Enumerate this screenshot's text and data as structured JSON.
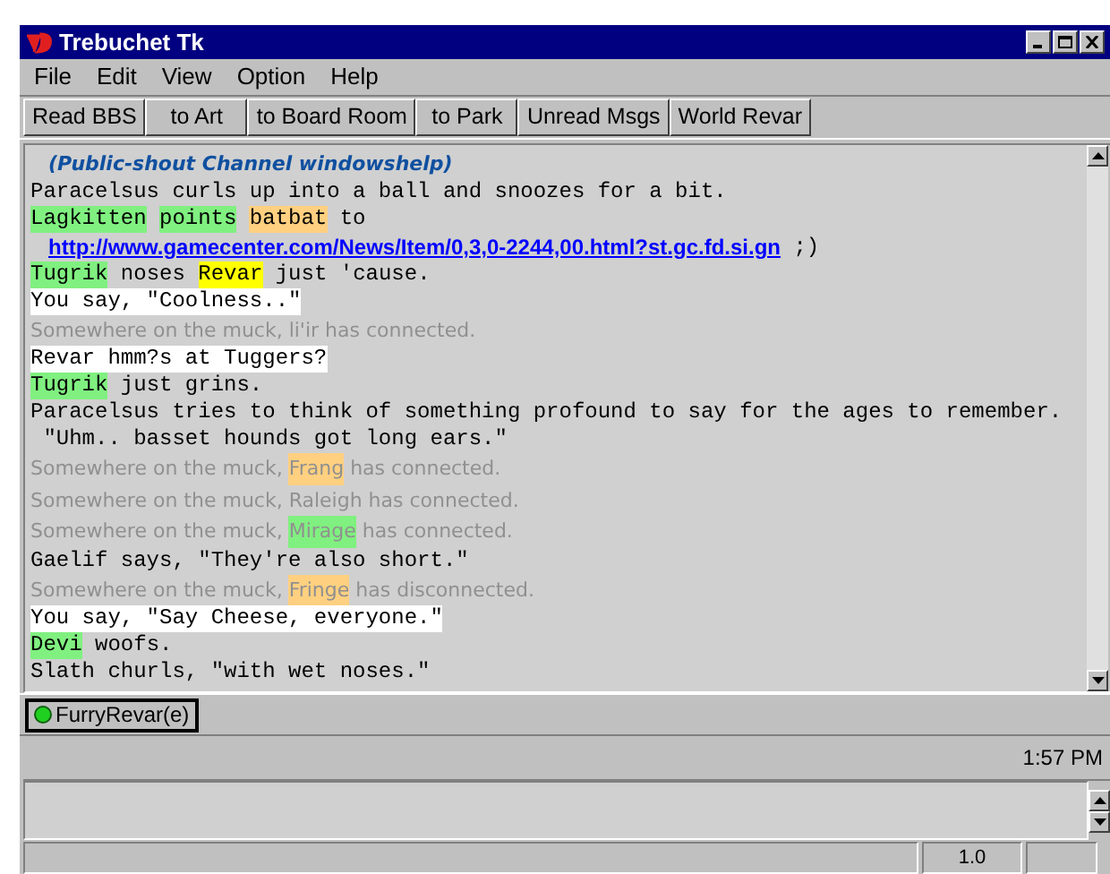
{
  "window": {
    "title": "Trebuchet Tk"
  },
  "menu": [
    "File",
    "Edit",
    "View",
    "Option",
    "Help"
  ],
  "toolbar": [
    "Read BBS",
    "to Art",
    "to Board Room",
    "to Park",
    "Unread Msgs",
    "World Revar"
  ],
  "lines": [
    {
      "kind": "header",
      "segments": [
        {
          "text": "(Public-shout Channel windowshelp)"
        }
      ]
    },
    {
      "kind": "text",
      "segments": [
        {
          "text": "Paracelsus curls up into a ball and snoozes for a bit."
        }
      ]
    },
    {
      "kind": "text",
      "segments": [
        {
          "text": "Lagkitten",
          "color": "#80f080",
          "space_after": true
        },
        {
          "text": "points",
          "color": "#80f080",
          "space_after": true
        },
        {
          "text": "batbat",
          "color": "#ffd080"
        },
        {
          "text": " to"
        }
      ]
    },
    {
      "kind": "link",
      "segments": [
        {
          "text": "http://www.gamecenter.com/News/Item/0,3,0-2244,00.html?st.gc.fd.si.gn",
          "link": true
        },
        {
          "text": " ;)"
        }
      ]
    },
    {
      "kind": "text",
      "segments": [
        {
          "text": "Tugrik",
          "color": "#80f080"
        },
        {
          "text": " noses "
        },
        {
          "text": "Revar",
          "color": "#ffff00"
        },
        {
          "text": " just 'cause."
        }
      ]
    },
    {
      "kind": "text",
      "self": true,
      "segments": [
        {
          "text": "You say, \"Coolness..\""
        }
      ]
    },
    {
      "kind": "system",
      "segments": [
        {
          "text": "Somewhere on the muck, li'ir has connected."
        }
      ]
    },
    {
      "kind": "text",
      "self": true,
      "segments": [
        {
          "text": "Revar hmm?s at Tuggers?"
        }
      ]
    },
    {
      "kind": "text",
      "segments": [
        {
          "text": "Tugrik",
          "color": "#80f080"
        },
        {
          "text": " just grins."
        }
      ]
    },
    {
      "kind": "text",
      "segments": [
        {
          "text": "Paracelsus tries to think of something profound to say for the ages to remember."
        }
      ]
    },
    {
      "kind": "text",
      "segments": [
        {
          "text": " \"Uhm.. basset hounds got long ears.\""
        }
      ]
    },
    {
      "kind": "system",
      "segments": [
        {
          "text": "Somewhere on the muck, "
        },
        {
          "text": "Frang",
          "color": "#ffd080"
        },
        {
          "text": " has connected."
        }
      ]
    },
    {
      "kind": "system",
      "segments": [
        {
          "text": "Somewhere on the muck, Raleigh has connected."
        }
      ]
    },
    {
      "kind": "system",
      "segments": [
        {
          "text": "Somewhere on the muck, "
        },
        {
          "text": "Mirage",
          "color": "#80f080"
        },
        {
          "text": " has connected."
        }
      ]
    },
    {
      "kind": "text",
      "segments": [
        {
          "text": "Gaelif says, \"They're also short.\""
        }
      ]
    },
    {
      "kind": "system",
      "segments": [
        {
          "text": "Somewhere on the muck, "
        },
        {
          "text": "Fringe",
          "color": "#ffd080"
        },
        {
          "text": " has disconnected."
        }
      ]
    },
    {
      "kind": "text",
      "self": true,
      "segments": [
        {
          "text": "You say, \"Say Cheese, everyone.\""
        }
      ]
    },
    {
      "kind": "text",
      "segments": [
        {
          "text": "Devi",
          "color": "#80f080"
        },
        {
          "text": " woofs."
        }
      ]
    },
    {
      "kind": "text",
      "segments": [
        {
          "text": "Slath churls, \"with wet noses.\""
        }
      ]
    }
  ],
  "world_tabs": [
    {
      "label": "FurryRevar(e)",
      "selected": true
    }
  ],
  "status": {
    "time": "1:57 PM",
    "line": "1.0"
  }
}
